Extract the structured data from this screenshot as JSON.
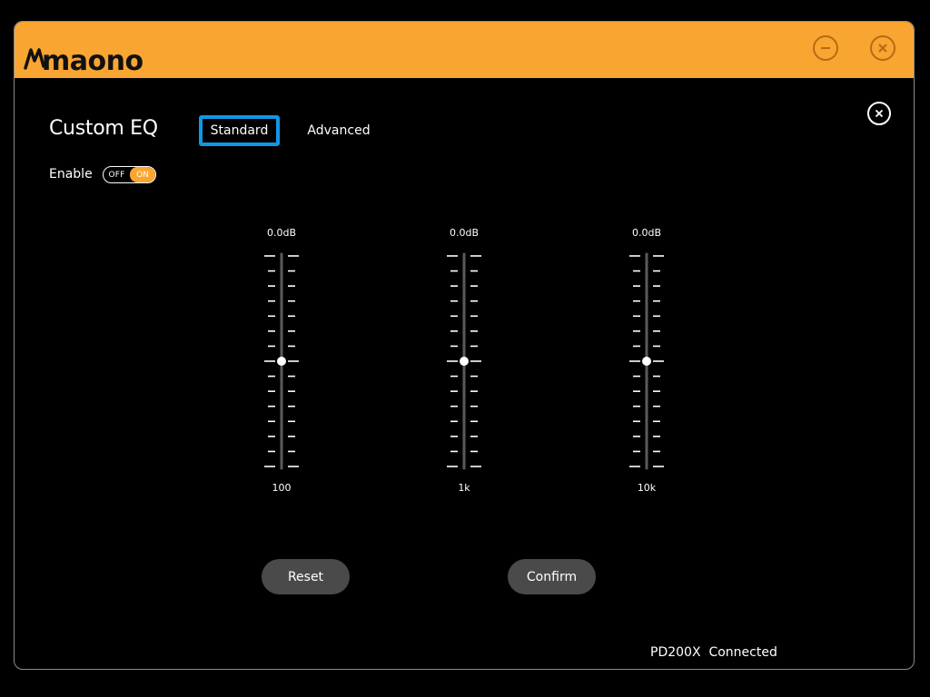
{
  "app": {
    "brand": "maono"
  },
  "panel": {
    "title": "Custom EQ",
    "tabs": [
      {
        "label": "Standard",
        "selected": true
      },
      {
        "label": "Advanced",
        "selected": false
      }
    ],
    "enable": {
      "label": "Enable",
      "off_label": "OFF",
      "on_label": "ON",
      "state": "ON"
    }
  },
  "eq": {
    "bands": [
      {
        "gain": "0.0dB",
        "freq": "100",
        "level": 0.5
      },
      {
        "gain": "0.0dB",
        "freq": "1k",
        "level": 0.5
      },
      {
        "gain": "0.0dB",
        "freq": "10k",
        "level": 0.5
      }
    ]
  },
  "buttons": {
    "reset": "Reset",
    "confirm": "Confirm"
  },
  "status": {
    "device": "PD200X",
    "state": "Connected"
  },
  "colors": {
    "accent": "#f9a531",
    "selected_tab_border": "#1197e8",
    "button_bg": "#4a4a4a"
  },
  "icons": {
    "minimize": "minimize-icon",
    "close": "close-icon",
    "panel_close": "close-circle-icon",
    "logo": "maono-logo"
  }
}
